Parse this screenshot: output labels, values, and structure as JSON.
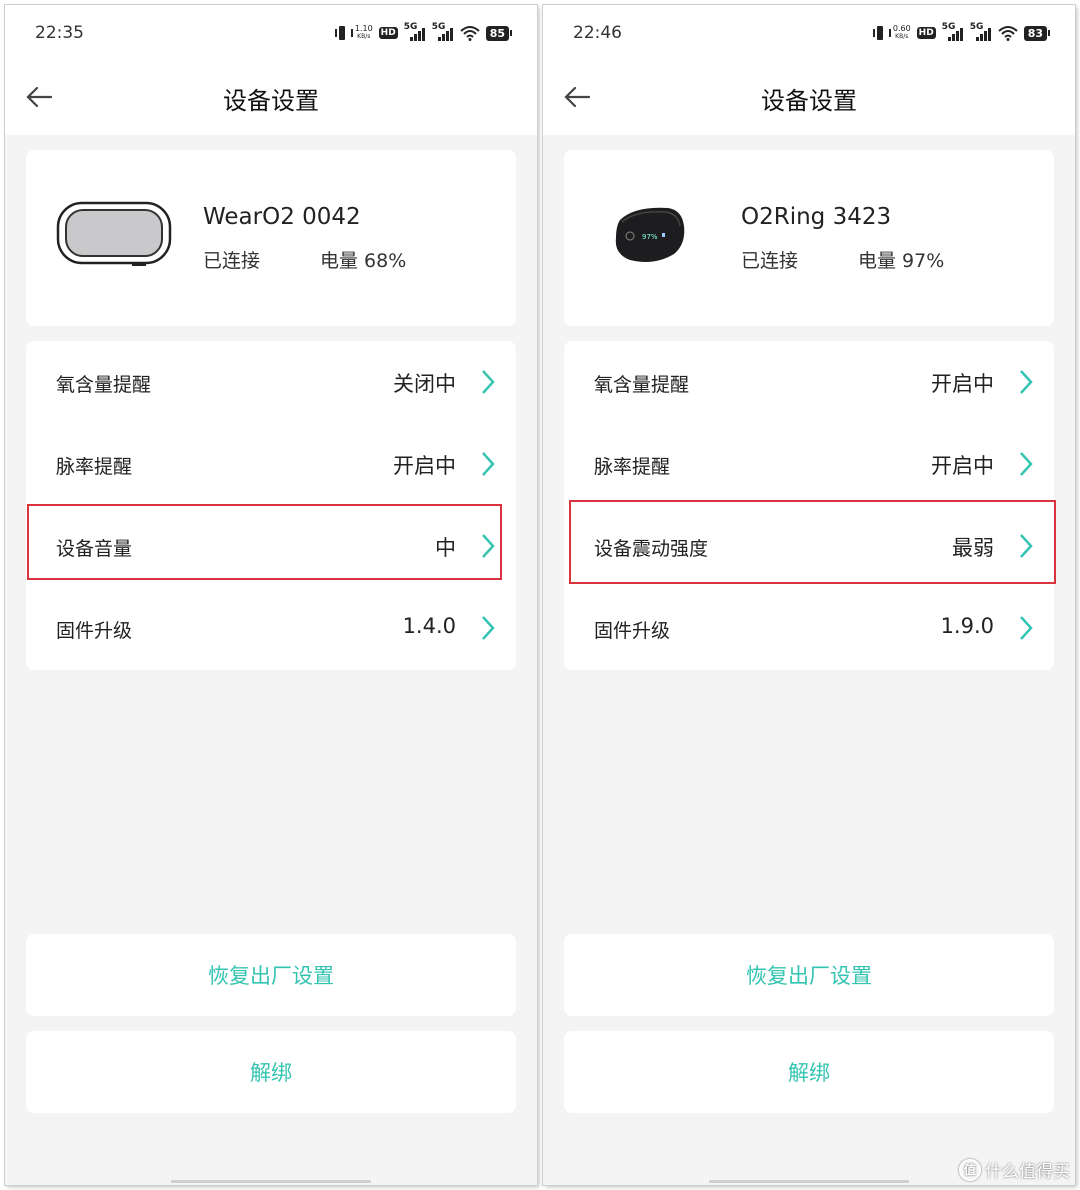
{
  "colors": {
    "accent": "#35c4b2",
    "highlight": "#d9333b",
    "background": "#f4f4f5"
  },
  "left": {
    "status": {
      "time": "22:35",
      "speed": "1.10",
      "speed_unit": "KB/s",
      "hd": "HD",
      "sig1": "5G",
      "sig2": "5G",
      "battery": "85"
    },
    "header": {
      "title": "设备设置",
      "back_icon": "arrow-left-icon"
    },
    "device": {
      "name": "WearO2 0042",
      "connection": "已连接",
      "battery": "电量 68%"
    },
    "settings": [
      {
        "label": "氧含量提醒",
        "value": "关闭中"
      },
      {
        "label": "脉率提醒",
        "value": "开启中"
      },
      {
        "label": "设备音量",
        "value": "中"
      },
      {
        "label": "固件升级",
        "value": "1.4.0"
      }
    ],
    "buttons": {
      "reset": "恢复出厂设置",
      "unbind": "解绑"
    }
  },
  "right": {
    "status": {
      "time": "22:46",
      "speed": "0.60",
      "speed_unit": "KB/s",
      "hd": "HD",
      "sig1": "5G",
      "sig2": "5G",
      "battery": "83"
    },
    "header": {
      "title": "设备设置",
      "back_icon": "arrow-left-icon"
    },
    "device": {
      "name": "O2Ring 3423",
      "connection": "已连接",
      "battery": "电量 97%",
      "screen_text": "97%"
    },
    "settings": [
      {
        "label": "氧含量提醒",
        "value": "开启中"
      },
      {
        "label": "脉率提醒",
        "value": "开启中"
      },
      {
        "label": "设备震动强度",
        "value": "最弱"
      },
      {
        "label": "固件升级",
        "value": "1.9.0"
      }
    ],
    "buttons": {
      "reset": "恢复出厂设置",
      "unbind": "解绑"
    }
  },
  "watermark": {
    "text": "什么值得买",
    "icon": "值"
  }
}
